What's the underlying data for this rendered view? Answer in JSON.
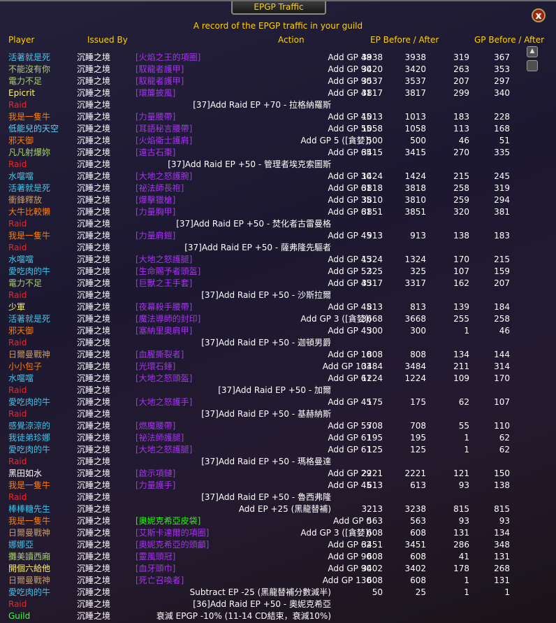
{
  "window": {
    "title": "EPGP Traffic",
    "close_label": "x"
  },
  "subtitle": "A record of the EPGP traffic in your guild",
  "headers": {
    "player": "Player",
    "issued_by": "Issued By",
    "action": "Action",
    "ep": "EP Before / After",
    "gp": "GP Before / After"
  },
  "colors": {
    "default": "#ffffff",
    "raid": "#ff2020",
    "guild": "#40ff40",
    "epic": "#a335ee",
    "uncommon": "#1eff00",
    "header": "#ffd100"
  },
  "rows": [
    {
      "player": "活著就是死",
      "pc": "#3fc7eb",
      "issuer": "沉睡之境",
      "item": "[火焰之王的項圈]",
      "ic": "#a335ee",
      "action": "Add GP 48",
      "ep1": "3938",
      "ep2": "3938",
      "gp1": "319",
      "gp2": "367"
    },
    {
      "player": "不能沒有你",
      "pc": "#a9d271",
      "issuer": "沉睡之境",
      "item": "[馭龍者護甲]",
      "ic": "#a335ee",
      "action": "Add GP 90",
      "ep1": "3420",
      "ep2": "3420",
      "gp1": "263",
      "gp2": "353"
    },
    {
      "player": "電力不足",
      "pc": "#a9d271",
      "issuer": "沉睡之境",
      "item": "[馭龍者護甲]",
      "ic": "#a335ee",
      "action": "Add GP 90",
      "ep1": "3537",
      "ep2": "3537",
      "gp1": "207",
      "gp2": "297"
    },
    {
      "player": "Epicrit",
      "pc": "#fff569",
      "issuer": "沉睡之境",
      "item": "[環簾披風]",
      "ic": "#a335ee",
      "action": "Add GP 41",
      "ep1": "3817",
      "ep2": "3817",
      "gp1": "299",
      "gp2": "340"
    },
    {
      "player": "Raid",
      "pc": "#ff2020",
      "issuer": "沉睡之境",
      "item": "",
      "ic": "",
      "action": "[37]Add Raid EP +70 - 拉格納羅斯",
      "wide": true,
      "ep1": "",
      "ep2": "",
      "gp1": "",
      "gp2": ""
    },
    {
      "player": "我是一隻牛",
      "pc": "#ff7d0a",
      "issuer": "沉睡之境",
      "item": "[力量腰帶]",
      "ic": "#a335ee",
      "action": "Add GP 45",
      "ep1": "1013",
      "ep2": "1013",
      "gp1": "183",
      "gp2": "228"
    },
    {
      "player": "低能兒的天空",
      "pc": "#69ccf0",
      "issuer": "沉睡之境",
      "item": "[耳語秘言腰帶]",
      "ic": "#a335ee",
      "action": "Add GP 55",
      "ep1": "1058",
      "ep2": "1058",
      "gp1": "113",
      "gp2": "168"
    },
    {
      "player": "邪天御",
      "pc": "#ff7d0a",
      "issuer": "沉睡之境",
      "item": "[火焰衛士護肩]",
      "ic": "#a335ee",
      "action": "Add GP 5 ([貪婪])",
      "ep1": "500",
      "ep2": "500",
      "gp1": "46",
      "gp2": "51"
    },
    {
      "player": "凡凡射爆妳",
      "pc": "#a9d271",
      "issuer": "沉睡之境",
      "item": "[遠古石棗]",
      "ic": "#a335ee",
      "action": "Add GP 65",
      "ep1": "3415",
      "ep2": "3415",
      "gp1": "270",
      "gp2": "335"
    },
    {
      "player": "Raid",
      "pc": "#ff2020",
      "issuer": "沉睡之境",
      "item": "",
      "ic": "",
      "action": "[37]Add Raid EP +50 - 管理者埃克索圖斯",
      "wide": true,
      "ep1": "",
      "ep2": "",
      "gp1": "",
      "gp2": ""
    },
    {
      "player": "水噹噹",
      "pc": "#3fc7eb",
      "issuer": "沉睡之境",
      "item": "[大地之怒護腕]",
      "ic": "#a335ee",
      "action": "Add GP 30",
      "ep1": "1424",
      "ep2": "1424",
      "gp1": "215",
      "gp2": "245"
    },
    {
      "player": "活著就是死",
      "pc": "#3fc7eb",
      "issuer": "沉睡之境",
      "item": "[祕法師長袍]",
      "ic": "#a335ee",
      "action": "Add GP 61",
      "ep1": "3818",
      "ep2": "3818",
      "gp1": "258",
      "gp2": "319"
    },
    {
      "player": "衝鋒釋放",
      "pc": "#c79c6e",
      "issuer": "沉睡之境",
      "item": "[爆擊獵槍]",
      "ic": "#a335ee",
      "action": "Add GP 35",
      "ep1": "3810",
      "ep2": "3810",
      "gp1": "259",
      "gp2": "294"
    },
    {
      "player": "大牛比較懶",
      "pc": "#ff7d0a",
      "issuer": "沉睡之境",
      "item": "[力量胸甲]",
      "ic": "#a335ee",
      "action": "Add GP 61",
      "ep1": "3851",
      "ep2": "3851",
      "gp1": "320",
      "gp2": "381"
    },
    {
      "player": "Raid",
      "pc": "#ff2020",
      "issuer": "沉睡之境",
      "item": "",
      "ic": "",
      "action": "[37]Add Raid EP +50 - 焚化者古雷曼格",
      "wide": true,
      "ep1": "",
      "ep2": "",
      "gp1": "",
      "gp2": ""
    },
    {
      "player": "我是一隻牛",
      "pc": "#ff7d0a",
      "issuer": "沉睡之境",
      "item": "[力量肩鎧]",
      "ic": "#a335ee",
      "action": "Add GP 45",
      "ep1": "913",
      "ep2": "913",
      "gp1": "138",
      "gp2": "183"
    },
    {
      "player": "Raid",
      "pc": "#ff2020",
      "issuer": "沉睡之境",
      "item": "",
      "ic": "",
      "action": "[37]Add Raid EP +50 - 薩弗隆先驅者",
      "wide": true,
      "ep1": "",
      "ep2": "",
      "gp1": "",
      "gp2": ""
    },
    {
      "player": "水噹噹",
      "pc": "#3fc7eb",
      "issuer": "沉睡之境",
      "item": "[大地之怒護腿]",
      "ic": "#a335ee",
      "action": "Add GP 45",
      "ep1": "1324",
      "ep2": "1324",
      "gp1": "170",
      "gp2": "215"
    },
    {
      "player": "愛吃肉的牛",
      "pc": "#3fc7eb",
      "issuer": "沉睡之境",
      "item": "[生命賜予者頭盔]",
      "ic": "#a335ee",
      "action": "Add GP 52",
      "ep1": "325",
      "ep2": "325",
      "gp1": "107",
      "gp2": "159"
    },
    {
      "player": "電力不足",
      "pc": "#a9d271",
      "issuer": "沉睡之境",
      "item": "[巨獸之王手套]",
      "ic": "#a335ee",
      "action": "Add GP 45",
      "ep1": "3317",
      "ep2": "3317",
      "gp1": "162",
      "gp2": "207"
    },
    {
      "player": "Raid",
      "pc": "#ff2020",
      "issuer": "沉睡之境",
      "item": "",
      "ic": "",
      "action": "[37]Add Raid EP +50 - 沙斯拉爾",
      "wide": true,
      "ep1": "",
      "ep2": "",
      "gp1": "",
      "gp2": ""
    },
    {
      "player": "少軍",
      "pc": "#fff569",
      "issuer": "沉睡之境",
      "item": "[夜幕殺手腰帶]",
      "ic": "#a335ee",
      "action": "Add GP 45",
      "ep1": "813",
      "ep2": "813",
      "gp1": "139",
      "gp2": "184"
    },
    {
      "player": "活著就是死",
      "pc": "#3fc7eb",
      "issuer": "沉睡之境",
      "item": "[魔法導師的封印]",
      "ic": "#a335ee",
      "action": "Add GP 3 ([貪婪])",
      "ep1": "3668",
      "ep2": "3668",
      "gp1": "255",
      "gp2": "258"
    },
    {
      "player": "邪天御",
      "pc": "#ff7d0a",
      "issuer": "沉睡之境",
      "item": "[塞納里奧肩甲]",
      "ic": "#a335ee",
      "action": "Add GP 45",
      "ep1": "300",
      "ep2": "300",
      "gp1": "1",
      "gp2": "46"
    },
    {
      "player": "Raid",
      "pc": "#ff2020",
      "issuer": "沉睡之境",
      "item": "",
      "ic": "",
      "action": "[37]Add Raid EP +50 - 迦頓男爵",
      "wide": true,
      "ep1": "",
      "ep2": "",
      "gp1": "",
      "gp2": ""
    },
    {
      "player": "日爾曼戰神",
      "pc": "#c79c6e",
      "issuer": "沉睡之境",
      "item": "[血腥撕裂者]",
      "ic": "#a335ee",
      "action": "Add GP 10",
      "ep1": "808",
      "ep2": "808",
      "gp1": "134",
      "gp2": "144"
    },
    {
      "player": "小小包子",
      "pc": "#ff7d0a",
      "issuer": "沉睡之境",
      "item": "[光環石錘]",
      "ic": "#a335ee",
      "action": "Add GP 103",
      "ep1": "3484",
      "ep2": "3484",
      "gp1": "211",
      "gp2": "314"
    },
    {
      "player": "水噹噹",
      "pc": "#3fc7eb",
      "issuer": "沉睡之境",
      "item": "[大地之怒頭盔]",
      "ic": "#a335ee",
      "action": "Add GP 61",
      "ep1": "1224",
      "ep2": "1224",
      "gp1": "109",
      "gp2": "170"
    },
    {
      "player": "Raid",
      "pc": "#ff2020",
      "issuer": "沉睡之境",
      "item": "",
      "ic": "",
      "action": "[37]Add Raid EP +50 - 加爾",
      "wide": true,
      "ep1": "",
      "ep2": "",
      "gp1": "",
      "gp2": ""
    },
    {
      "player": "愛吃肉的牛",
      "pc": "#3fc7eb",
      "issuer": "沉睡之境",
      "item": "[大地之怒護手]",
      "ic": "#a335ee",
      "action": "Add GP 45",
      "ep1": "175",
      "ep2": "175",
      "gp1": "62",
      "gp2": "107"
    },
    {
      "player": "Raid",
      "pc": "#ff2020",
      "issuer": "沉睡之境",
      "item": "",
      "ic": "",
      "action": "[37]Add Raid EP +50 - 基赫納斯",
      "wide": true,
      "ep1": "",
      "ep2": "",
      "gp1": "",
      "gp2": ""
    },
    {
      "player": "感覺涼涼的",
      "pc": "#3fc7eb",
      "issuer": "沉睡之境",
      "item": "[燃魔腰帶]",
      "ic": "#a335ee",
      "action": "Add GP 55",
      "ep1": "708",
      "ep2": "708",
      "gp1": "55",
      "gp2": "110"
    },
    {
      "player": "我徒弟珍娜",
      "pc": "#3fc7eb",
      "issuer": "沉睡之境",
      "item": "[祕法師護腿]",
      "ic": "#a335ee",
      "action": "Add GP 61",
      "ep1": "195",
      "ep2": "195",
      "gp1": "1",
      "gp2": "62"
    },
    {
      "player": "愛吃肉的牛",
      "pc": "#3fc7eb",
      "issuer": "沉睡之境",
      "item": "[大地之怒護腿]",
      "ic": "#a335ee",
      "action": "Add GP 61",
      "ep1": "125",
      "ep2": "125",
      "gp1": "1",
      "gp2": "62"
    },
    {
      "player": "Raid",
      "pc": "#ff2020",
      "issuer": "沉睡之境",
      "item": "",
      "ic": "",
      "action": "[37]Add Raid EP +50 - 瑪格曼達",
      "wide": true,
      "ep1": "",
      "ep2": "",
      "gp1": "",
      "gp2": ""
    },
    {
      "player": "黑田如水",
      "pc": "#ffffff",
      "issuer": "沉睡之境",
      "item": "[啟示項鏈]",
      "ic": "#a335ee",
      "action": "Add GP 29",
      "ep1": "2221",
      "ep2": "2221",
      "gp1": "121",
      "gp2": "150"
    },
    {
      "player": "我是一隻牛",
      "pc": "#ff7d0a",
      "issuer": "沉睡之境",
      "item": "[力量護手]",
      "ic": "#a335ee",
      "action": "Add GP 45",
      "ep1": "613",
      "ep2": "613",
      "gp1": "93",
      "gp2": "138"
    },
    {
      "player": "Raid",
      "pc": "#ff2020",
      "issuer": "沉睡之境",
      "item": "",
      "ic": "",
      "action": "[37]Add Raid EP +50 - 魯西弗隆",
      "wide": true,
      "ep1": "",
      "ep2": "",
      "gp1": "",
      "gp2": ""
    },
    {
      "player": "棒棒糖先生",
      "pc": "#3fc7eb",
      "issuer": "沉睡之境",
      "item": "",
      "ic": "",
      "action": "Add EP +25 (黑龍替補)",
      "wide": true,
      "ep1": "3213",
      "ep2": "3238",
      "gp1": "815",
      "gp2": "815"
    },
    {
      "player": "我是一隻牛",
      "pc": "#ff7d0a",
      "issuer": "沉睡之境",
      "item": "[奧妮克希亞皮袋]",
      "ic": "#1eff00",
      "action": "Add GP 0",
      "ep1": "563",
      "ep2": "563",
      "gp1": "93",
      "gp2": "93"
    },
    {
      "player": "日爾曼戰神",
      "pc": "#c79c6e",
      "issuer": "沉睡之境",
      "item": "[艾斯卡達爾的項圈]",
      "ic": "#a335ee",
      "action": "Add GP 3 ([貪婪])",
      "ep1": "608",
      "ep2": "608",
      "gp1": "131",
      "gp2": "134"
    },
    {
      "player": "娜娜亞",
      "pc": "#3fc7eb",
      "issuer": "沉睡之境",
      "item": "[奧妮克希亞的頭顱]",
      "ic": "#a335ee",
      "action": "Add GP 62",
      "ep1": "3451",
      "ep2": "3451",
      "gp1": "286",
      "gp2": "348"
    },
    {
      "player": "攤美讀西廂",
      "pc": "#a9d271",
      "issuer": "沉睡之境",
      "item": "[靈風頭冠]",
      "ic": "#a335ee",
      "action": "Add GP 90",
      "ep1": "608",
      "ep2": "608",
      "gp1": "41",
      "gp2": "131"
    },
    {
      "player": "開個六給他",
      "pc": "#fff569",
      "issuer": "沉睡之境",
      "item": "[血牙頭巾]",
      "ic": "#a335ee",
      "action": "Add GP 90",
      "ep1": "3402",
      "ep2": "3402",
      "gp1": "178",
      "gp2": "268"
    },
    {
      "player": "日爾曼戰神",
      "pc": "#c79c6e",
      "issuer": "沉睡之境",
      "item": "[死亡召喚者]",
      "ic": "#a335ee",
      "action": "Add GP 130",
      "ep1": "608",
      "ep2": "608",
      "gp1": "1",
      "gp2": "131"
    },
    {
      "player": "愛吃肉的牛",
      "pc": "#3fc7eb",
      "issuer": "沉睡之境",
      "item": "",
      "ic": "",
      "action": "Subtract EP -25 (黑龍替補分數減半)",
      "wide": true,
      "ep1": "50",
      "ep2": "25",
      "gp1": "1",
      "gp2": "1"
    },
    {
      "player": "Raid",
      "pc": "#ff2020",
      "issuer": "沉睡之境",
      "item": "",
      "ic": "",
      "action": "[36]Add Raid EP +50 - 奧妮克希亞",
      "wide": true,
      "ep1": "",
      "ep2": "",
      "gp1": "",
      "gp2": ""
    },
    {
      "player": "Guild",
      "pc": "#40ff40",
      "issuer": "沉睡之境",
      "item": "",
      "ic": "",
      "action": "衰減 EPGP -10% (11-14 CD結束，衰減10%)",
      "wide": true,
      "ep1": "",
      "ep2": "",
      "gp1": "",
      "gp2": ""
    }
  ],
  "scrollbar": {
    "up_icon": "▲"
  }
}
